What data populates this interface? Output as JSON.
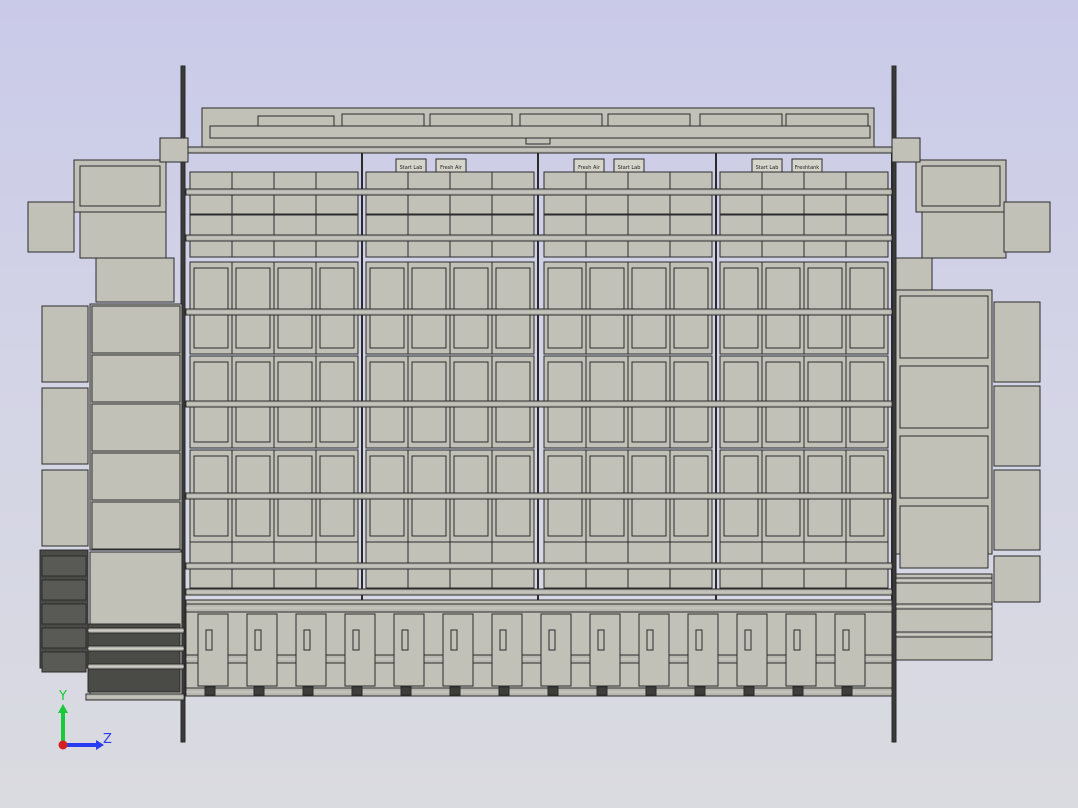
{
  "viewport": {
    "background_top": "#c9cae8",
    "background_bottom": "#dadbe0"
  },
  "model": {
    "body_color": "#c2c1b8",
    "edge_color": "#2b2b2b",
    "dark_part_color": "#4a4a46",
    "rail_color": "#b9b8b0",
    "top_labels": [
      "Start Lab",
      "Fresh Air",
      "Fresh Air",
      "Start Lab",
      "Start Lab",
      "Freshtank"
    ]
  },
  "triad": {
    "y_label": "Y",
    "z_label": "Z",
    "y_color": "#19c93a",
    "z_color": "#2a3cf0",
    "x_color": "#d42020"
  }
}
